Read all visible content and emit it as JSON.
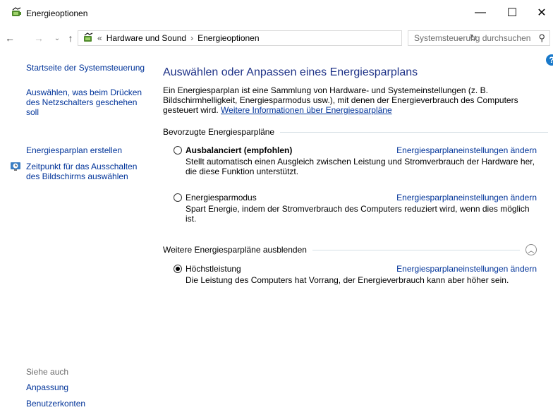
{
  "window": {
    "title": "Energieoptionen",
    "icon": "power-options-icon",
    "minimize_glyph": "—",
    "maximize_glyph": "☐",
    "close_glyph": "✕"
  },
  "address_bar": {
    "back_glyph": "←",
    "forward_glyph": "→",
    "recent_glyph": "⌄",
    "up_glyph": "↑",
    "overflow": "«",
    "crumbs": [
      "Hardware und Sound",
      "Energieoptionen"
    ],
    "separator": "›",
    "dropdown_glyph": "⌄",
    "refresh_glyph": "↻"
  },
  "search": {
    "placeholder": "Systemsteuerung durchsuchen",
    "icon_glyph": "⚲"
  },
  "help_glyph": "?",
  "sidebar": {
    "home": "Startseite der Systemsteuerung",
    "power_button": "Auswählen, was beim Drücken des Netzschalters geschehen soll",
    "create_plan": "Energiesparplan erstellen",
    "display_off": "Zeitpunkt für das Ausschalten des Bildschirms auswählen",
    "see_also": "Siehe auch",
    "personalization": "Anpassung",
    "user_accounts": "Benutzerkonten"
  },
  "main": {
    "title": "Auswählen oder Anpassen eines Energiesparplans",
    "intro": "Ein Energiesparplan ist eine Sammlung von Hardware- und Systemeinstellungen (z. B. Bildschirmhelligkeit, Energiesparmodus usw.), mit denen der Energieverbrauch des Computers gesteuert wird. ",
    "intro_link": "Weitere Informationen über Energiesparpläne",
    "preferred_header": "Bevorzugte Energiesparpläne",
    "more_header": "Weitere Energiesparpläne ausblenden",
    "collapse_glyph": "︿",
    "plans": [
      {
        "name": "Ausbalanciert (empfohlen)",
        "selected": false,
        "link": "Energiesparplaneinstellungen ändern",
        "description": "Stellt automatisch einen Ausgleich zwischen Leistung und Stromverbrauch der Hardware her, die diese Funktion unterstützt."
      },
      {
        "name": "Energiesparmodus",
        "selected": false,
        "link": "Energiesparplaneinstellungen ändern",
        "description": "Spart Energie, indem der Stromverbrauch des Computers reduziert wird, wenn dies möglich ist."
      },
      {
        "name": "Höchstleistung",
        "selected": true,
        "link": "Energiesparplaneinstellungen ändern",
        "description": "Die Leistung des Computers hat Vorrang, der Energieverbrauch kann aber höher sein."
      }
    ]
  },
  "colors": {
    "link": "#003399",
    "title": "#1e3287",
    "muted": "#6d6d6d",
    "separator": "#d5dfe5"
  }
}
